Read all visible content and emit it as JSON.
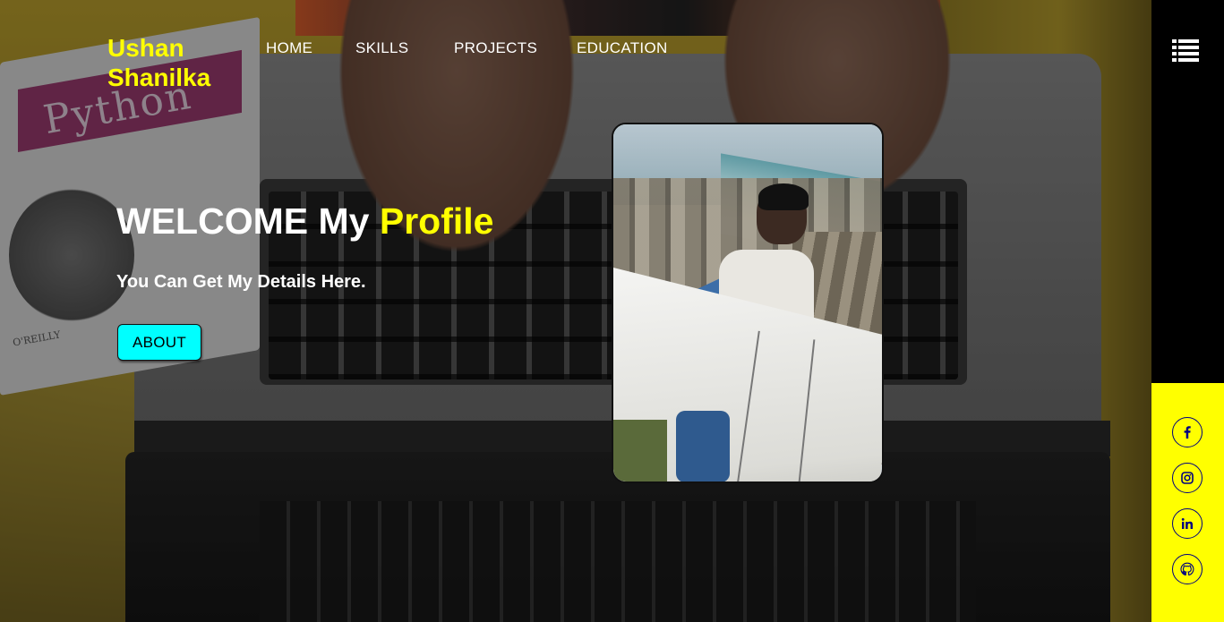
{
  "brand": {
    "line1": "Ushan",
    "line2": "Shanilka",
    "color": "#ffff00"
  },
  "nav": {
    "items": [
      {
        "label": "HOME"
      },
      {
        "label": "SKILLS"
      },
      {
        "label": "PROJECTS"
      },
      {
        "label": "EDUCATION"
      }
    ]
  },
  "hero": {
    "welcome_prefix": "WELCOME My",
    "welcome_highlight": "Profile",
    "subtitle": "You Can Get My Details Here.",
    "about_button": "ABOUT",
    "button_color": "#00ffff",
    "background_book": {
      "title": "Python",
      "publisher": "O'REILLY"
    }
  },
  "side_panel": {
    "menu_icon": "list-menu-icon",
    "top_color": "#000000",
    "bottom_color": "#ffff00",
    "social_links": [
      {
        "icon": "facebook-icon"
      },
      {
        "icon": "instagram-icon"
      },
      {
        "icon": "linkedin-icon"
      },
      {
        "icon": "github-icon"
      }
    ]
  },
  "profile_photo": {
    "subject": "profile-photo"
  }
}
